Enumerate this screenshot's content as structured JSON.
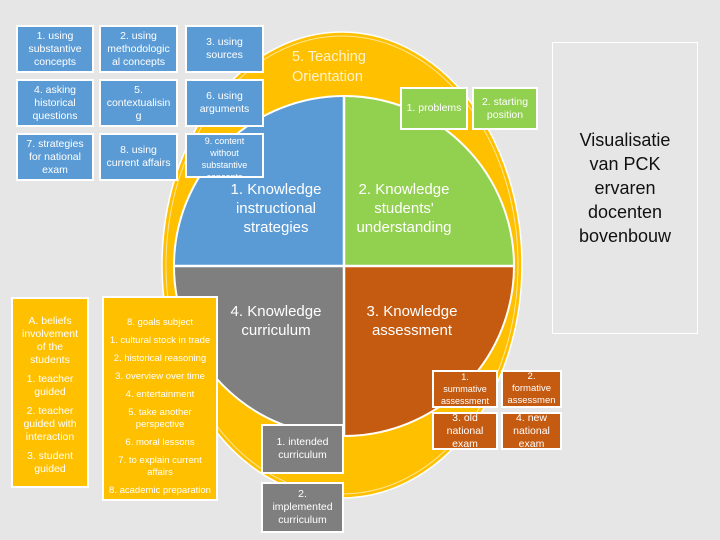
{
  "colors": {
    "background": "#e7e6e6",
    "instructional": "#5b9bd5",
    "students": "#92d050",
    "curriculum": "#7f7f7f",
    "assessment": "#c55a11",
    "orientation": "#ffc000"
  },
  "title": {
    "lines": [
      "Visualisatie",
      "van PCK",
      "ervaren",
      "docenten",
      "bovenbouw"
    ]
  },
  "orientation": {
    "label_line1": "5. Teaching",
    "label_line2": "Orientation"
  },
  "quadrants": {
    "instructional": {
      "lines": [
        "1. Knowledge",
        "instructional",
        "strategies"
      ]
    },
    "students": {
      "lines": [
        "2. Knowledge",
        "students'",
        "understanding"
      ]
    },
    "curriculum": {
      "lines": [
        "4. Knowledge",
        "curriculum"
      ]
    },
    "assessment": {
      "lines": [
        "3. Knowledge",
        "assessment"
      ]
    }
  },
  "strategies": [
    {
      "line1": "1. using",
      "line2": "substantive",
      "line3": "concepts"
    },
    {
      "line1": "2. using",
      "line2": "methodologic",
      "line3": "al concepts"
    },
    {
      "line1": "3. using",
      "line2": "sources",
      "line3": ""
    },
    {
      "line1": "4. asking",
      "line2": "historical",
      "line3": "questions"
    },
    {
      "line1": "5.",
      "line2": "contextualisin",
      "line3": "g"
    },
    {
      "line1": "6. using",
      "line2": "arguments",
      "line3": ""
    },
    {
      "line1": "7. strategies",
      "line2": "for national",
      "line3": "exam"
    },
    {
      "line1": "8. using",
      "line2": "current affairs",
      "line3": ""
    },
    {
      "line1": "9. content",
      "line2": "without",
      "line3": "substantive",
      "line4": "concepts"
    }
  ],
  "students_items": [
    {
      "line1": "1. problems",
      "line2": ""
    },
    {
      "line1": "2. starting",
      "line2": "position"
    }
  ],
  "curriculum_items": [
    {
      "line1": "1. intended",
      "line2": "curriculum",
      "line3": ""
    },
    {
      "line1": "2.",
      "line2": "implemented",
      "line3": "curriculum"
    }
  ],
  "assessment_items": [
    {
      "line1": "1.",
      "line2": "summative",
      "line3": "assessment"
    },
    {
      "line1": "2.",
      "line2": "formative",
      "line3": "assessmen",
      "line4": "t"
    },
    {
      "line1": "3. old",
      "line2": "national",
      "line3": "exam"
    },
    {
      "line1": "4. new",
      "line2": "national",
      "line3": "exam"
    }
  ],
  "beliefs": {
    "heading": [
      "A. beliefs",
      "involvement",
      "of the",
      "students"
    ],
    "items": [
      "1. teacher guided",
      "2. teacher guided with interaction",
      "3. student guided"
    ]
  },
  "goals": {
    "heading": "8. goals subject",
    "items": [
      "1. cultural stock in trade",
      "2. historical reasoning",
      "3. overview over time",
      "4. entertainment",
      "5. take another perspective",
      "6. moral lessons",
      "7. to explain current affairs",
      "8. academic preparation"
    ]
  }
}
